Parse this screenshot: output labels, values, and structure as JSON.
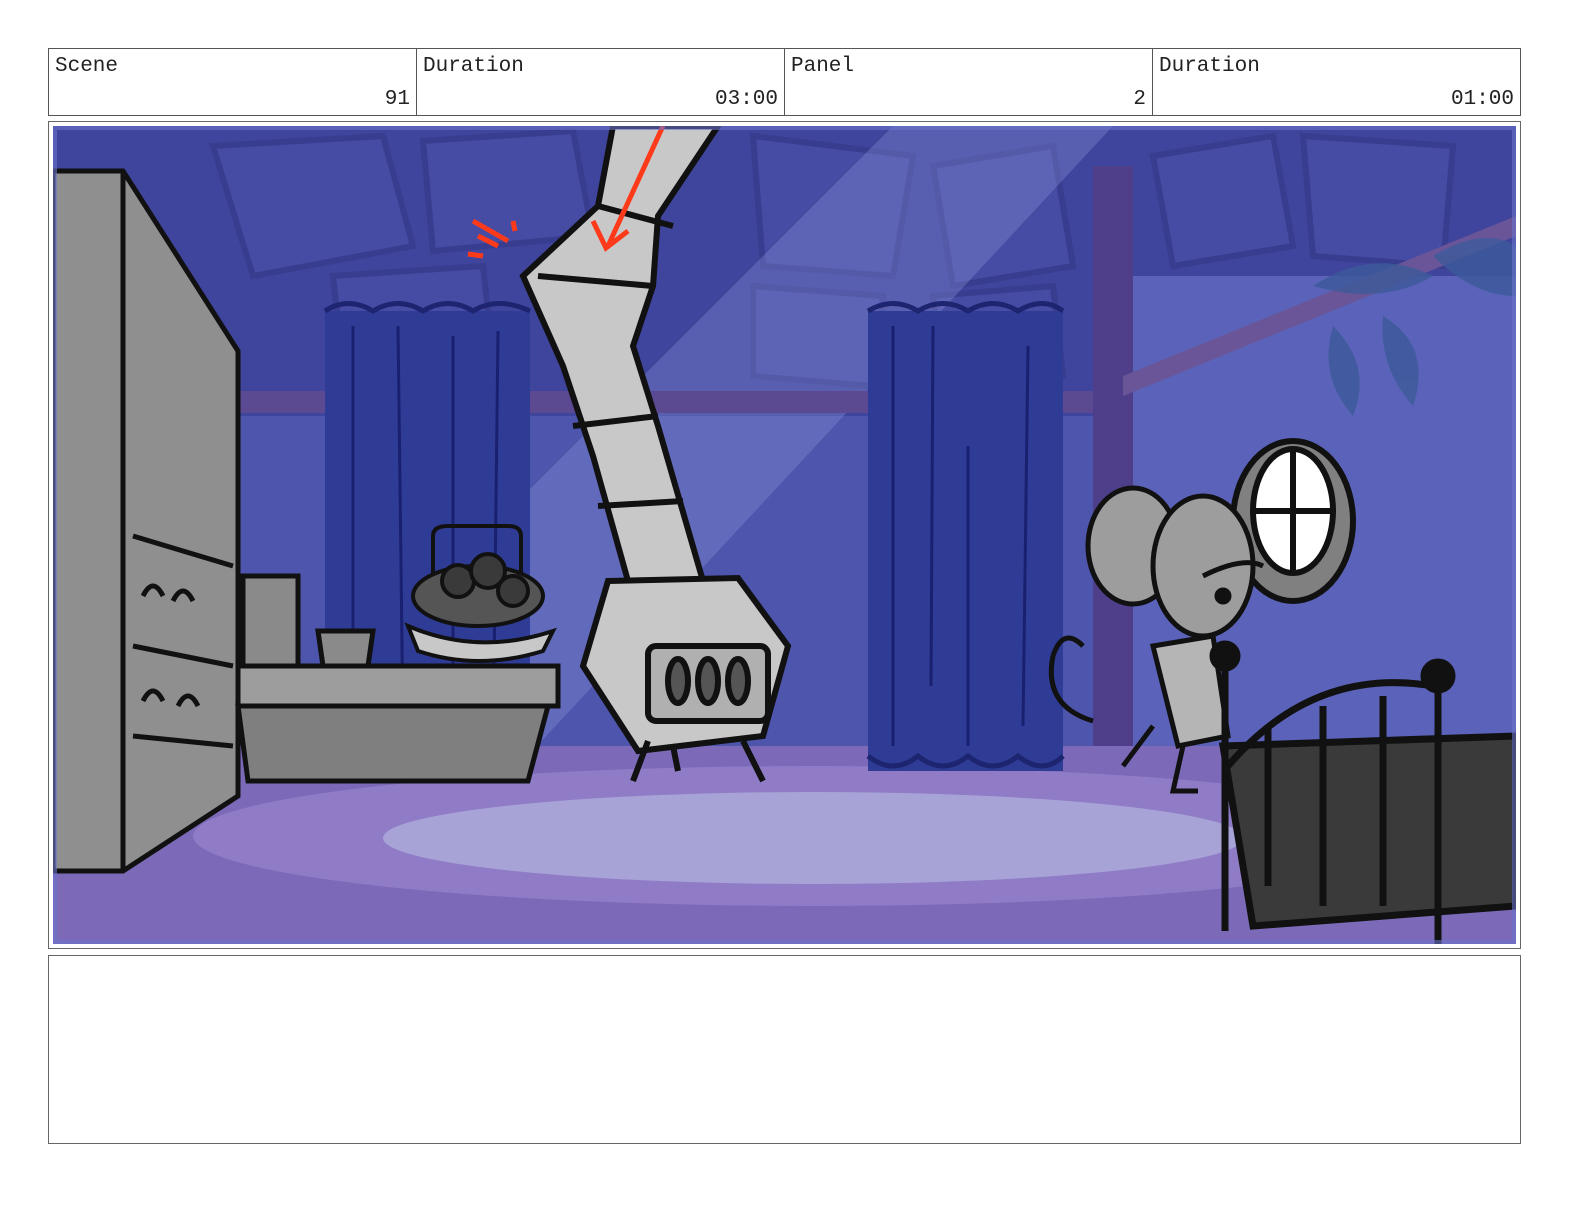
{
  "header": {
    "scene_label": "Scene",
    "scene_value": "91",
    "scene_duration_label": "Duration",
    "scene_duration_value": "03:00",
    "panel_label": "Panel",
    "panel_value": "2",
    "panel_duration_label": "Duration",
    "panel_duration_value": "01:00"
  },
  "panel": {
    "colors": {
      "wall": "#3f449c",
      "wall_light": "#5a5fb8",
      "floor": "#7c6ab8",
      "rug": "#a7a3d6",
      "curtain": "#2f3c95",
      "sketch_gray": "#9d9d9d",
      "sketch_light": "#c8c8c8",
      "annotation": "#ff3a1a"
    }
  },
  "notes": {
    "text": ""
  }
}
